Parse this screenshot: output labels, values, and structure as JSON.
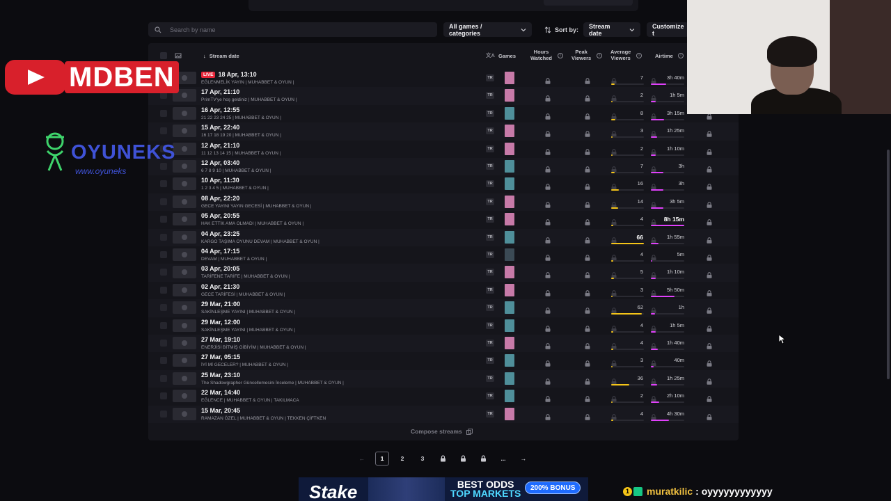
{
  "toolbar": {
    "search_placeholder": "Search by name",
    "filter_label": "All games / categories",
    "sort_label": "Sort by:",
    "sort_value": "Stream date",
    "customize_label": "Customize t"
  },
  "table": {
    "headers": {
      "stream_date": "Stream date",
      "games": "Games",
      "hours_watched_1": "Hours",
      "hours_watched_2": "Watched",
      "peak_viewers_1": "Peak",
      "peak_viewers_2": "Viewers",
      "avg_viewers_1": "Average",
      "avg_viewers_2": "Viewers",
      "airtime": "Airtime"
    },
    "live_badge": "LIVE",
    "rows": [
      {
        "date": "18 Apr, 13:10",
        "title": "EĞLENMELİK YAYIN | MUHABBET & OYUN |",
        "lang": "TR",
        "game": "pink",
        "avg": "7",
        "avg_frac": 0.11,
        "airtime": "3h 40m",
        "air_frac": 0.45,
        "live": true
      },
      {
        "date": "17 Apr, 21:10",
        "title": "PrimTV'ye hoş geldiniz | MUHABBET & OYUN |",
        "lang": "TR",
        "game": "pink",
        "avg": "2",
        "avg_frac": 0.03,
        "airtime": "1h 5m",
        "air_frac": 0.14,
        "live": false
      },
      {
        "date": "16 Apr, 12:55",
        "title": "21 22 23 24 25 | MUHABBET & OYUN |",
        "lang": "TR",
        "game": "teal",
        "avg": "8",
        "avg_frac": 0.12,
        "airtime": "3h 15m",
        "air_frac": 0.4,
        "live": false
      },
      {
        "date": "15 Apr, 22:40",
        "title": "16 17 18 19 20 | MUHABBET & OYUN |",
        "lang": "TR",
        "game": "pink",
        "avg": "3",
        "avg_frac": 0.05,
        "airtime": "1h 25m",
        "air_frac": 0.18,
        "live": false
      },
      {
        "date": "12 Apr, 21:10",
        "title": "11 12 13 14 15 | MUHABBET & OYUN |",
        "lang": "TR",
        "game": "pink",
        "avg": "2",
        "avg_frac": 0.03,
        "airtime": "1h 10m",
        "air_frac": 0.15,
        "live": false
      },
      {
        "date": "12 Apr, 03:40",
        "title": "6 7 8 9 10 | MUHABBET & OYUN |",
        "lang": "TR",
        "game": "teal",
        "avg": "7",
        "avg_frac": 0.11,
        "airtime": "3h",
        "air_frac": 0.37,
        "live": false
      },
      {
        "date": "10 Apr, 11:30",
        "title": "1 2 3 4 5 | MUHABBET & OYUN |",
        "lang": "TR",
        "game": "teal",
        "avg": "16",
        "avg_frac": 0.24,
        "airtime": "3h",
        "air_frac": 0.37,
        "live": false
      },
      {
        "date": "08 Apr, 22:20",
        "title": "GECE YAYINI YAYIN GECESİ | MUHABBET & OYUN |",
        "lang": "TR",
        "game": "pink",
        "avg": "14",
        "avg_frac": 0.21,
        "airtime": "3h 5m",
        "air_frac": 0.38,
        "live": false
      },
      {
        "date": "05 Apr, 20:55",
        "title": "HAK ETTİK AMA OLMADI | MUHABBET & OYUN |",
        "lang": "TR",
        "game": "pink",
        "avg": "4",
        "avg_frac": 0.06,
        "airtime": "8h 15m",
        "air_frac": 1.0,
        "live": false,
        "air_big": true
      },
      {
        "date": "04 Apr, 23:25",
        "title": "KARGO TAŞIMA OYUNU DEVAM | MUHABBET & OYUN |",
        "lang": "TR",
        "game": "teal",
        "avg": "66",
        "avg_frac": 1.0,
        "airtime": "1h 55m",
        "air_frac": 0.23,
        "live": false,
        "avg_big": true
      },
      {
        "date": "04 Apr, 17:15",
        "title": "DEVAM | MUHABBET & OYUN |",
        "lang": "TR",
        "game": "dark",
        "avg": "4",
        "avg_frac": 0.06,
        "airtime": "5m",
        "air_frac": 0.02,
        "live": false
      },
      {
        "date": "03 Apr, 20:05",
        "title": "TARİFENE TARİFE | MUHABBET & OYUN |",
        "lang": "TR",
        "game": "pink",
        "avg": "5",
        "avg_frac": 0.08,
        "airtime": "1h 10m",
        "air_frac": 0.15,
        "live": false
      },
      {
        "date": "02 Apr, 21:30",
        "title": "GECE TARİFESİ | MUHABBET & OYUN |",
        "lang": "TR",
        "game": "pink",
        "avg": "3",
        "avg_frac": 0.05,
        "airtime": "5h 50m",
        "air_frac": 0.71,
        "live": false
      },
      {
        "date": "29 Mar, 21:00",
        "title": "SAKİNLEŞME YAYINI | MUHABBET & OYUN |",
        "lang": "TR",
        "game": "teal",
        "avg": "62",
        "avg_frac": 0.94,
        "airtime": "1h",
        "air_frac": 0.12,
        "live": false
      },
      {
        "date": "29 Mar, 12:00",
        "title": "SAKİNLEŞME YAYINI | MUHABBET & OYUN |",
        "lang": "TR",
        "game": "teal",
        "avg": "4",
        "avg_frac": 0.06,
        "airtime": "1h 5m",
        "air_frac": 0.14,
        "live": false
      },
      {
        "date": "27 Mar, 19:10",
        "title": "ENERJİSİ BİTMİŞ GİBİYİM | MUHABBET & OYUN |",
        "lang": "TR",
        "game": "pink",
        "avg": "4",
        "avg_frac": 0.06,
        "airtime": "1h 40m",
        "air_frac": 0.2,
        "live": false
      },
      {
        "date": "27 Mar, 05:15",
        "title": "İYİ Mİ GECELER? | MUHABBET & OYUN |",
        "lang": "TR",
        "game": "teal",
        "avg": "3",
        "avg_frac": 0.05,
        "airtime": "40m",
        "air_frac": 0.08,
        "live": false
      },
      {
        "date": "25 Mar, 23:10",
        "title": "The Shadowgrapher Güncellemesini İnceleme | MUHABBET & OYUN |",
        "lang": "TR",
        "game": "teal",
        "avg": "36",
        "avg_frac": 0.55,
        "airtime": "1h 25m",
        "air_frac": 0.18,
        "live": false
      },
      {
        "date": "22 Mar, 14:40",
        "title": "EĞLENCE | MUHABBET & OYUN | TAKILMACA",
        "lang": "TR",
        "game": "teal",
        "avg": "2",
        "avg_frac": 0.03,
        "airtime": "2h 10m",
        "air_frac": 0.26,
        "live": false
      },
      {
        "date": "15 Mar, 20:45",
        "title": "RAMAZAN ÖZEL | MUHABBET & OYUN | TEKKEN ÇİFTKEN",
        "lang": "TR",
        "game": "pink",
        "avg": "4",
        "avg_frac": 0.06,
        "airtime": "4h 30m",
        "air_frac": 0.55,
        "live": false
      }
    ],
    "compose_label": "Compose streams"
  },
  "pagination": {
    "pages": [
      "1",
      "2",
      "3"
    ],
    "ellipsis": "...",
    "current": "1"
  },
  "overlays": {
    "yt_channel": "MDBEN",
    "sponsor_name": "OYUNEKS",
    "sponsor_url": "www.oyuneks",
    "ad_brand": "Stake",
    "ad_line1": "BEST ODDS",
    "ad_line2": "TOP MARKETS",
    "ad_bonus": "200% BONUS",
    "chat_user": "muratkilic",
    "chat_message": ": oyyyyyyyyyyyy"
  },
  "colors": {
    "avg_bar": "#f5c518",
    "air_bar": "#e040fb",
    "live": "#e8263a",
    "game_pink": "#c77aa8",
    "game_teal": "#4f8f9a",
    "game_dark": "#3b4a55"
  },
  "icons": {
    "search": "search-icon",
    "sort": "sort-arrows-icon",
    "lock": "lock-icon",
    "info": "info-icon",
    "chevron": "chevron-down-icon",
    "compose": "copy-icon"
  }
}
